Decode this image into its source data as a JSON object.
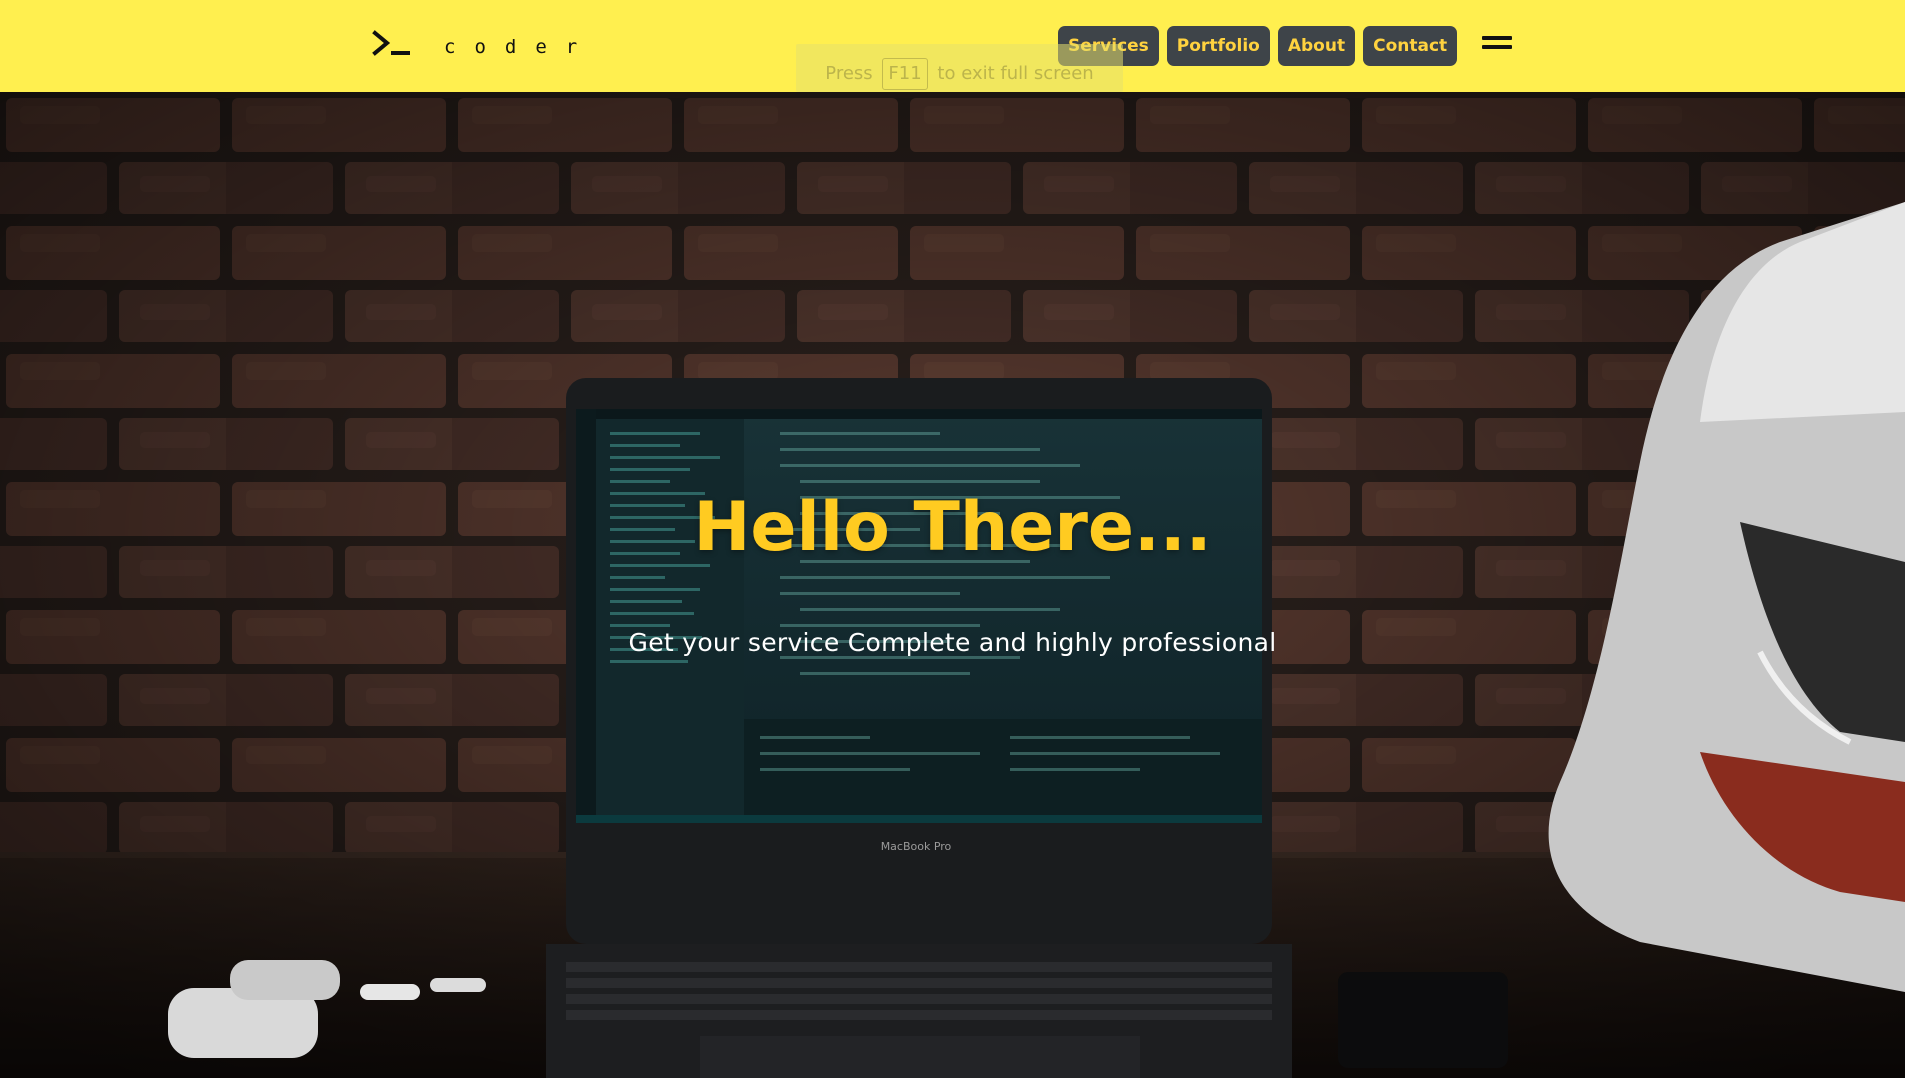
{
  "brand": {
    "name": "coder",
    "icon": "terminal-prompt-icon"
  },
  "nav": {
    "links": [
      "Services",
      "Portfolio",
      "About",
      "Contact"
    ],
    "menu_icon": "hamburger-menu-icon"
  },
  "fullscreen_notice": {
    "before": "Press",
    "key": "F11",
    "after": "to exit full screen"
  },
  "hero": {
    "title": "Hello There...",
    "subtitle": "Get your service Complete and highly professional",
    "laptop_label": "MacBook Pro"
  },
  "colors": {
    "header_background": "#ffef4f",
    "nav_button_background": "#3e4449",
    "nav_button_text": "#ffd23f",
    "hero_title": "#ffcb21",
    "hero_subtitle": "#ffffff"
  }
}
